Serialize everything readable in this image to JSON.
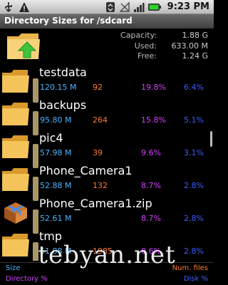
{
  "status_bar": {
    "time": "9:23 PM",
    "icons": [
      "usb-icon",
      "warning-icon",
      "sync-icon",
      "no-signal-icon",
      "signal-icon",
      "battery-icon"
    ]
  },
  "title": "Directory Sizes for /sdcard",
  "summary": {
    "capacity_label": "Capacity:",
    "capacity_value": "1.88 G",
    "used_label": "Used:",
    "used_value": "633.00 M",
    "free_label": "Free:",
    "free_value": "1.24 G"
  },
  "entries": [
    {
      "name": "testdata",
      "size": "120.15 M",
      "files": "92",
      "dir_pct": "19.8%",
      "pct2": "6.4%",
      "icon": "folder-icon"
    },
    {
      "name": "backups",
      "size": "95.80 M",
      "files": "264",
      "dir_pct": "15.8%",
      "pct2": "5.1%",
      "icon": "folder-icon"
    },
    {
      "name": "pic4",
      "size": "57.98 M",
      "files": "39",
      "dir_pct": "9.6%",
      "pct2": "3.1%",
      "icon": "folder-icon"
    },
    {
      "name": "Phone_Camera1",
      "size": "52.88 M",
      "files": "132",
      "dir_pct": "8.7%",
      "pct2": "2.8%",
      "icon": "folder-icon"
    },
    {
      "name": "Phone_Camera1.zip",
      "size": "52.61 M",
      "files": "",
      "dir_pct": "8.7%",
      "pct2": "2.8%",
      "icon": "archive-box-icon"
    },
    {
      "name": "tmp",
      "size": "51.88 M",
      "files": "1985",
      "dir_pct": "8.6%",
      "pct2": "2.8%",
      "icon": "folder-icon"
    }
  ],
  "footer": {
    "size_label": "Size",
    "dir_pct_label": "Directory %",
    "files_label": "Num. files",
    "pct2_label": "Disk %"
  },
  "watermark": "tebyan.net",
  "colors": {
    "size": "#4ab4ff",
    "files": "#ff7a2e",
    "dir_pct": "#d040ff",
    "pct2": "#3a5dff"
  }
}
